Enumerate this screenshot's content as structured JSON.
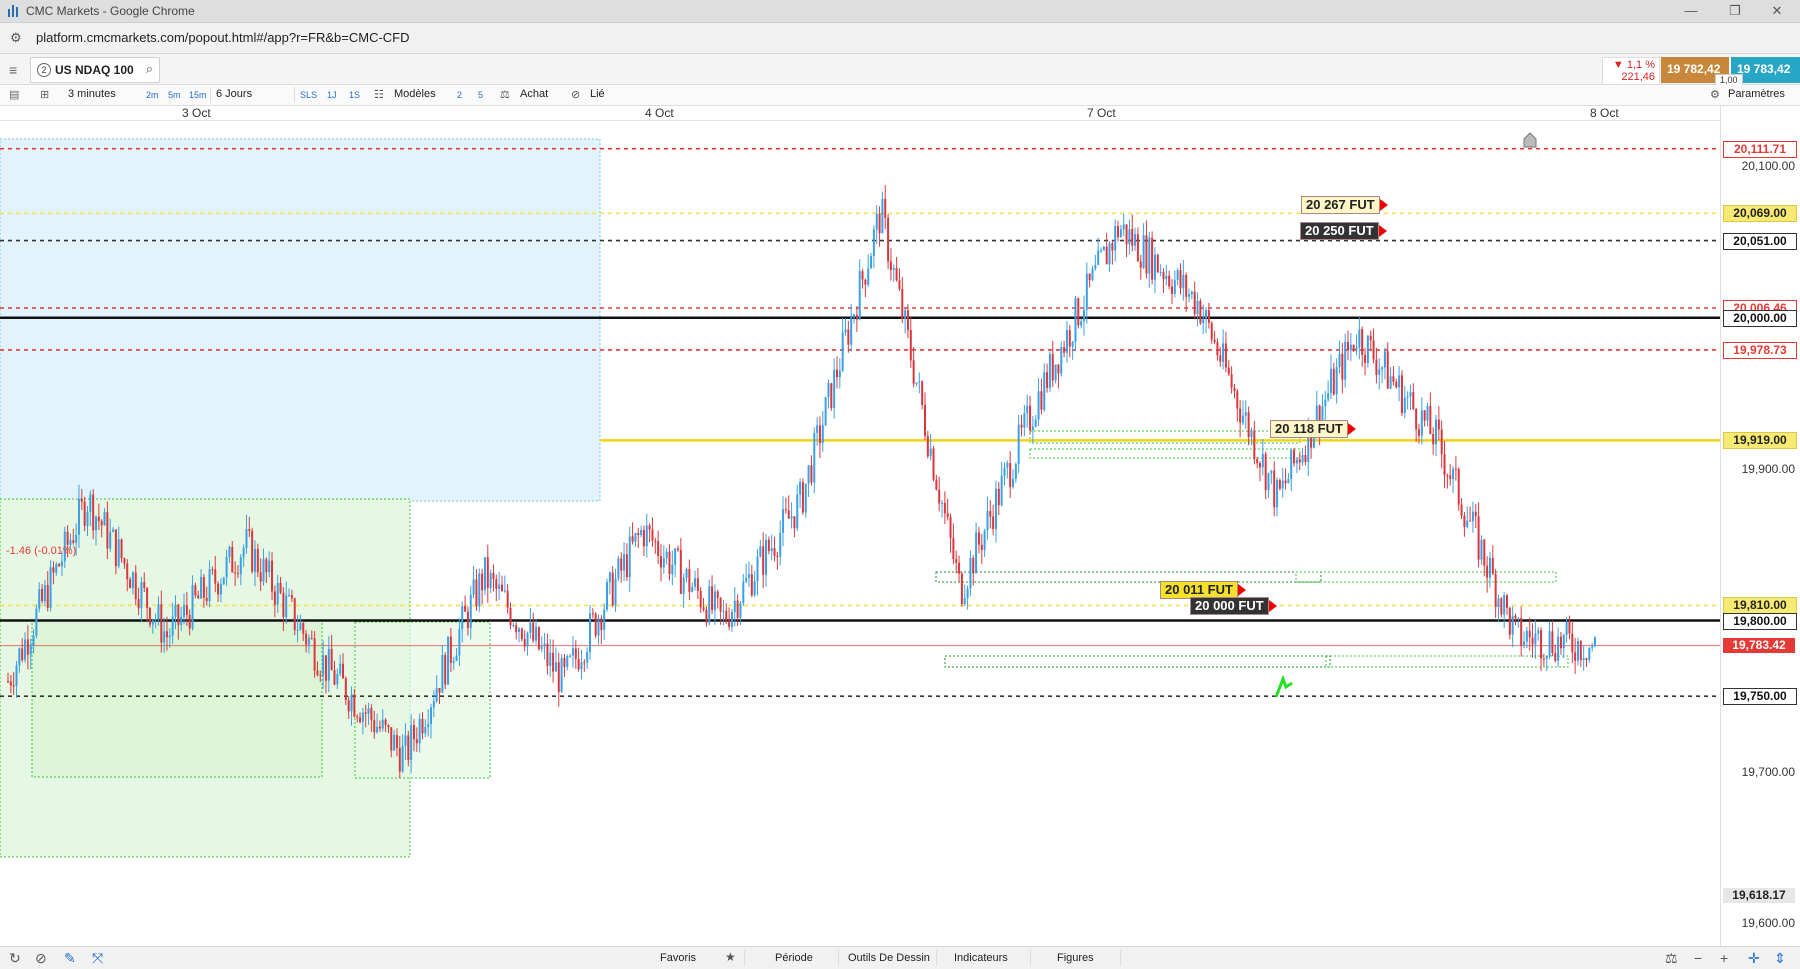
{
  "window": {
    "title": "CMC Markets - Google Chrome"
  },
  "browser": {
    "url": "platform.cmcmarkets.com/popout.html#/app?r=FR&b=CMC-CFD"
  },
  "instrument": {
    "index": "2",
    "name": "US NDAQ 100",
    "change_pct": "▼ 1,1 %",
    "change_abs": "221,46",
    "sell": "19 782,42",
    "buy": "19 783,42",
    "spread": "1,00"
  },
  "toolbar": {
    "interval": "3 minutes",
    "quick_intervals": [
      "2m",
      "5m",
      "15m"
    ],
    "period": "6 Jours",
    "quick_periods": [
      "SLS",
      "1J",
      "1S"
    ],
    "templates": "Modèles",
    "counts": [
      "2",
      "5"
    ],
    "buy": "Achat",
    "link": "Lié",
    "settings": "Paramètres"
  },
  "chart_data": {
    "type": "candlestick",
    "x_labels": [
      "3 Oct",
      "4 Oct",
      "7 Oct",
      "8 Oct"
    ],
    "y_ticks": [
      "20,100.00",
      "19,900.00",
      "19,700.00",
      "19,600.00"
    ],
    "ylim": [
      19585,
      20130
    ],
    "approx_price_path": [
      {
        "t": "3 Oct",
        "price": 19760
      },
      {
        "t": "3 Oct",
        "price": 19880
      },
      {
        "t": "3 Oct",
        "price": 19790
      },
      {
        "t": "3 Oct",
        "price": 19850
      },
      {
        "t": "3 Oct",
        "price": 19770
      },
      {
        "t": "3 Oct",
        "price": 19710
      },
      {
        "t": "4 Oct",
        "price": 19830
      },
      {
        "t": "4 Oct",
        "price": 19760
      },
      {
        "t": "4 Oct",
        "price": 19860
      },
      {
        "t": "4 Oct",
        "price": 19800
      },
      {
        "t": "4 Oct",
        "price": 19880
      },
      {
        "t": "7 Oct",
        "price": 20070
      },
      {
        "t": "7 Oct",
        "price": 19820
      },
      {
        "t": "7 Oct",
        "price": 19950
      },
      {
        "t": "7 Oct",
        "price": 20060
      },
      {
        "t": "7 Oct",
        "price": 20010
      },
      {
        "t": "7 Oct",
        "price": 19880
      },
      {
        "t": "7 Oct",
        "price": 19990
      },
      {
        "t": "7 Oct",
        "price": 19920
      },
      {
        "t": "8 Oct",
        "price": 19790
      },
      {
        "t": "8 Oct",
        "price": 19783
      }
    ],
    "levels": [
      {
        "label": "20,111.71",
        "color": "#e53935",
        "style": "dashed",
        "price": 20111.71
      },
      {
        "label": "20,069.00",
        "color": "#f3e34a",
        "style": "dashed",
        "price": 20069.0
      },
      {
        "label": "20,051.00",
        "color": "#333333",
        "style": "dashed",
        "price": 20051.0
      },
      {
        "label": "20,006.46",
        "color": "#e53935",
        "style": "dashed",
        "price": 20006.46
      },
      {
        "label": "20,000.00",
        "color": "#111111",
        "style": "solid",
        "price": 20000.0
      },
      {
        "label": "19,978.73",
        "color": "#e53935",
        "style": "dashed",
        "price": 19978.73
      },
      {
        "label": "19,919.00",
        "color": "#f2d21a",
        "style": "solid",
        "price": 19919.0
      },
      {
        "label": "19,810.00",
        "color": "#f3e34a",
        "style": "dashed",
        "price": 19810.0
      },
      {
        "label": "19,800.00",
        "color": "#111111",
        "style": "solid",
        "price": 19800.0
      },
      {
        "label": "19,783.42",
        "color": "#e53935",
        "style": "current",
        "price": 19783.42
      },
      {
        "label": "19,750.00",
        "color": "#333333",
        "style": "dashed",
        "price": 19750.0
      },
      {
        "label": "19,618.17",
        "color": "#555555",
        "style": "low",
        "price": 19618.17
      }
    ],
    "annotations": [
      {
        "text": "20 267 FUT",
        "price": 20069.0
      },
      {
        "text": "20 250 FUT",
        "price": 20051.0
      },
      {
        "text": "20 118 FUT",
        "price": 19919.0
      },
      {
        "text": "20 011 FUT",
        "price": 19810.0
      },
      {
        "text": "20 000 FUT",
        "price": 19800.0
      }
    ],
    "current_label": "-1.46 (-0.01%)"
  },
  "bottom": {
    "favorites": "Favoris",
    "period": "Période",
    "drawing_tools": "Outils De Dessin",
    "indicators": "Indicateurs",
    "figures": "Figures"
  },
  "colors": {
    "up": "#3aa0e6",
    "down": "#d9373d",
    "blue_zone": "#e2f3fb",
    "green_zone": "#e8f9e6"
  }
}
